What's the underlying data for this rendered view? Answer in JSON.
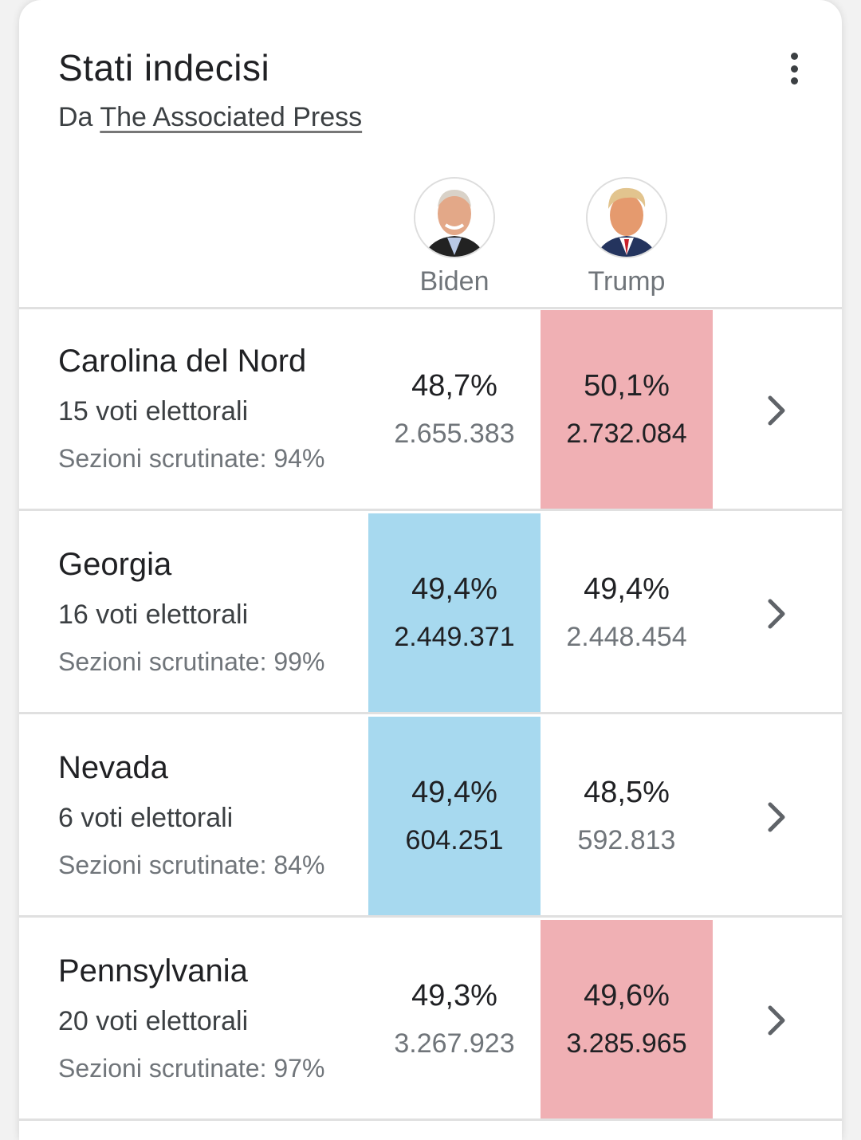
{
  "header": {
    "title": "Stati indecisi",
    "source_prefix": "Da",
    "source_link": "The Associated Press"
  },
  "candidates": [
    {
      "name": "Biden",
      "party_color": "#a7d9ef"
    },
    {
      "name": "Trump",
      "party_color": "#f0b0b4"
    }
  ],
  "states": [
    {
      "name": "Carolina del Nord",
      "electoral_votes": "15 voti elettorali",
      "reporting": "Sezioni scrutinate: 94%",
      "biden": {
        "pct": "48,7%",
        "votes": "2.655.383"
      },
      "trump": {
        "pct": "50,1%",
        "votes": "2.732.084"
      },
      "leader": "trump"
    },
    {
      "name": "Georgia",
      "electoral_votes": "16 voti elettorali",
      "reporting": "Sezioni scrutinate: 99%",
      "biden": {
        "pct": "49,4%",
        "votes": "2.449.371"
      },
      "trump": {
        "pct": "49,4%",
        "votes": "2.448.454"
      },
      "leader": "biden"
    },
    {
      "name": "Nevada",
      "electoral_votes": "6 voti elettorali",
      "reporting": "Sezioni scrutinate: 84%",
      "biden": {
        "pct": "49,4%",
        "votes": "604.251"
      },
      "trump": {
        "pct": "48,5%",
        "votes": "592.813"
      },
      "leader": "biden"
    },
    {
      "name": "Pennsylvania",
      "electoral_votes": "20 voti elettorali",
      "reporting": "Sezioni scrutinate: 97%",
      "biden": {
        "pct": "49,3%",
        "votes": "3.267.923"
      },
      "trump": {
        "pct": "49,6%",
        "votes": "3.285.965"
      },
      "leader": "trump"
    }
  ]
}
